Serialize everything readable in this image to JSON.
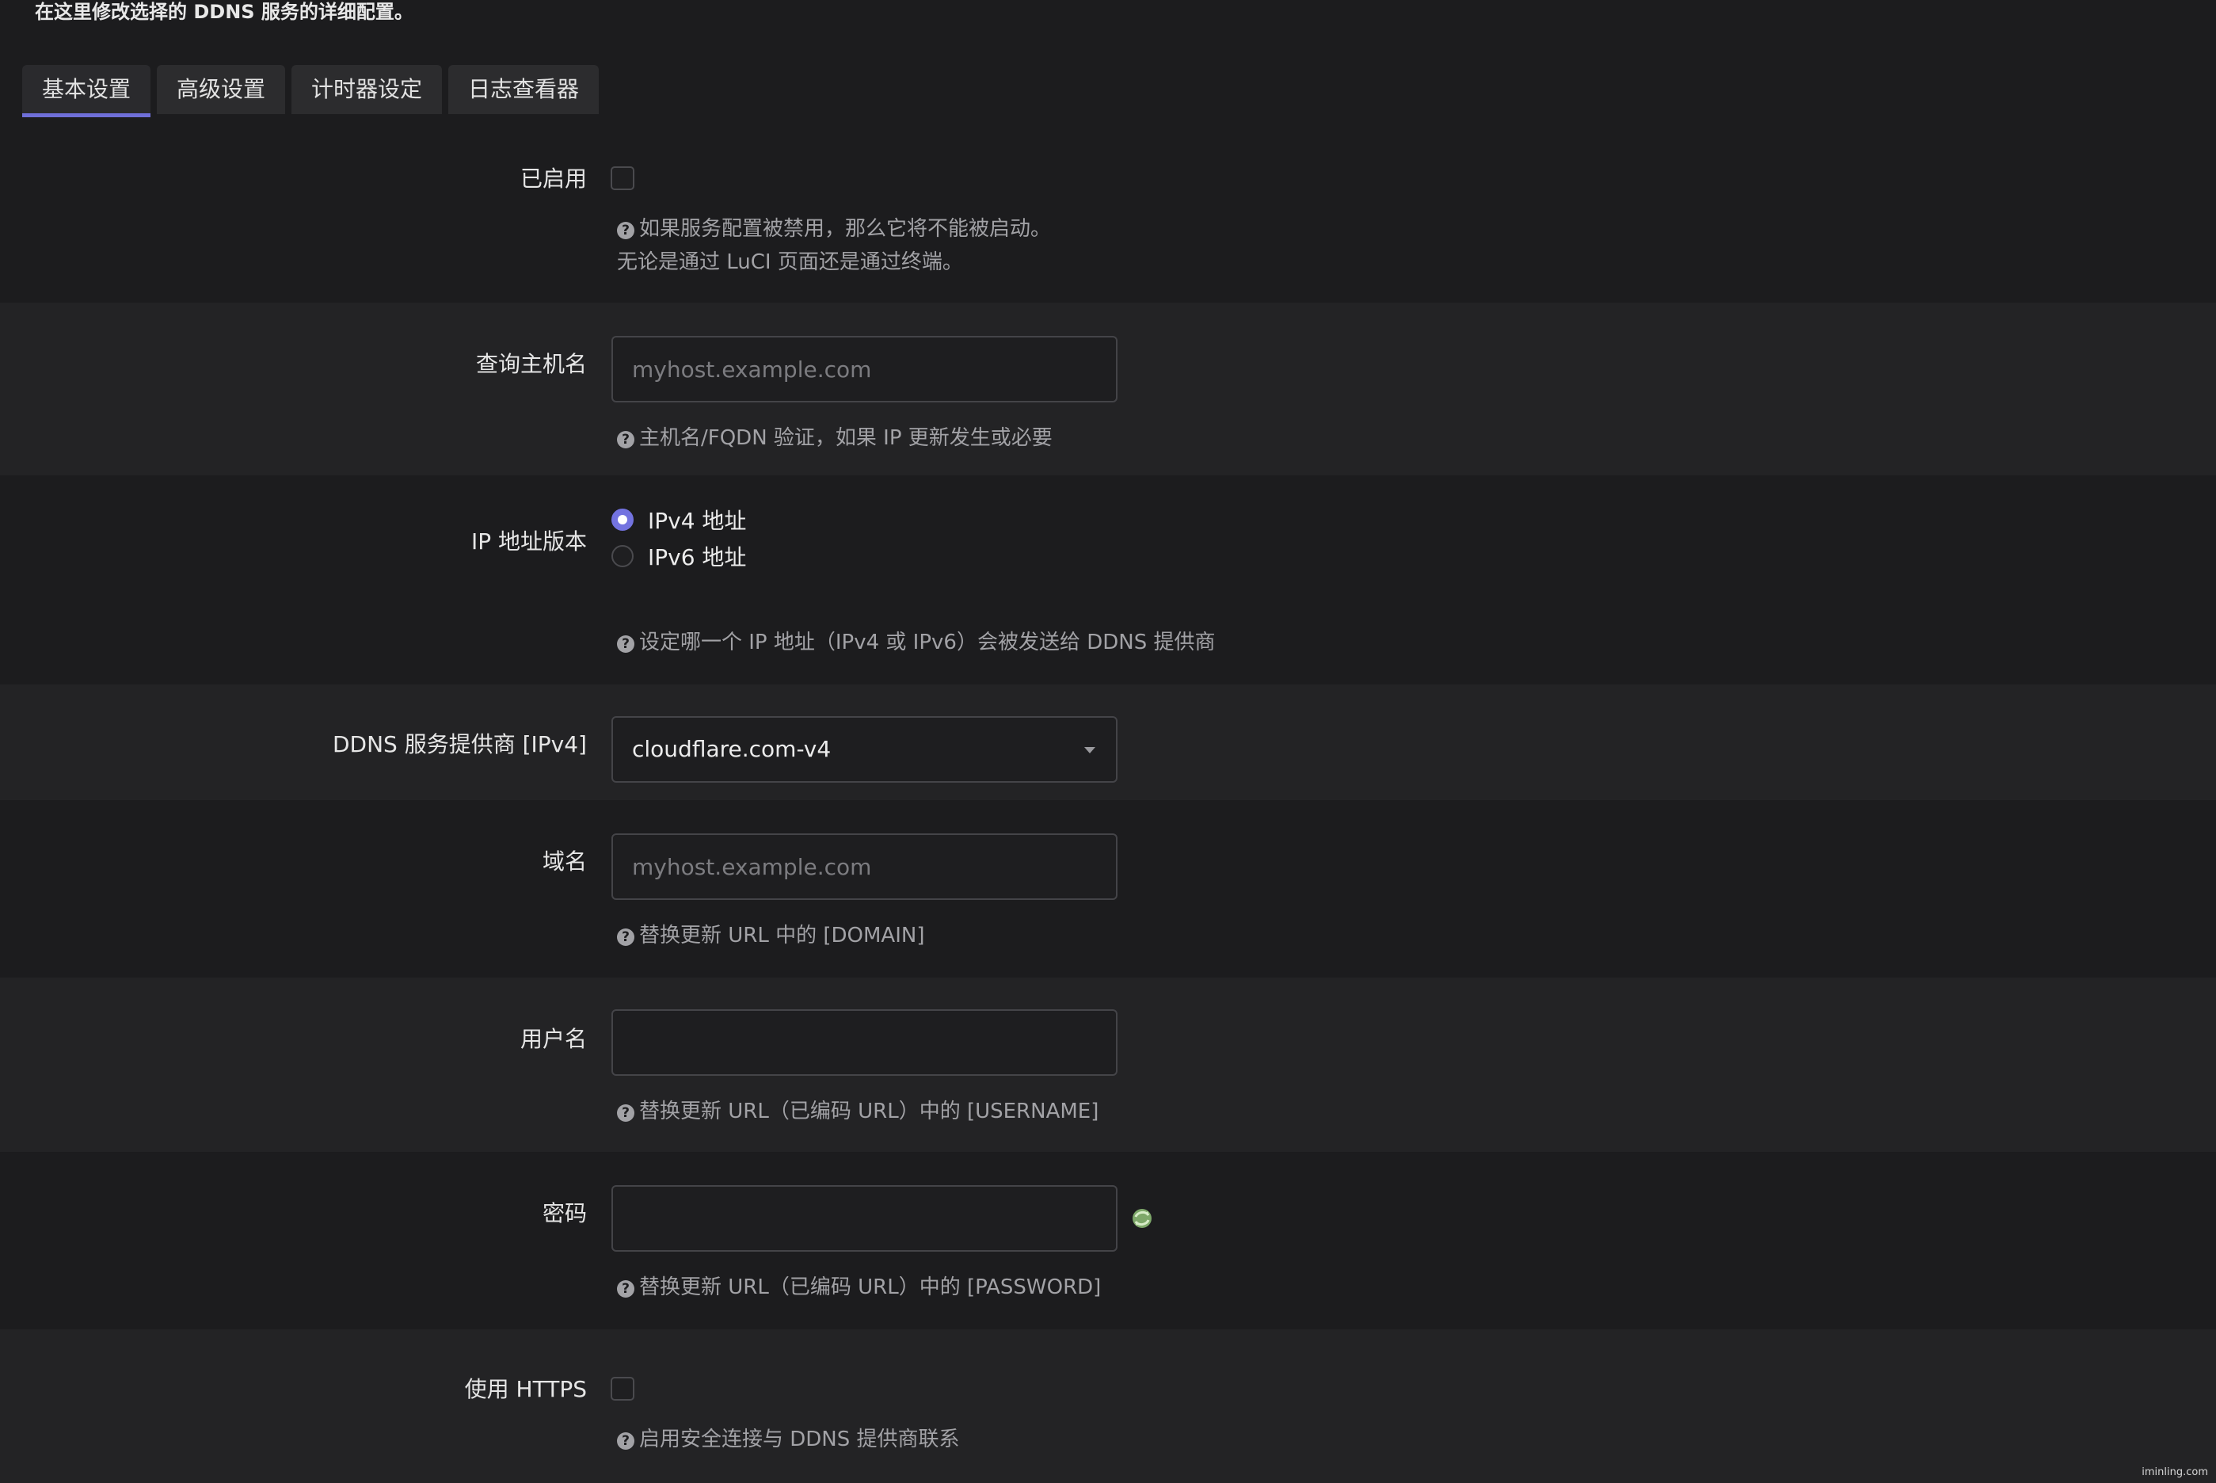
{
  "page": {
    "description": "在这里修改选择的 DDNS 服务的详细配置。",
    "watermark": "iminling.com"
  },
  "tabs": [
    {
      "label": "基本设置",
      "active": true
    },
    {
      "label": "高级设置",
      "active": false
    },
    {
      "label": "计时器设定",
      "active": false
    },
    {
      "label": "日志查看器",
      "active": false
    }
  ],
  "fields": {
    "enabled": {
      "label": "已启用",
      "checked": false,
      "help_line1": "如果服务配置被禁用，那么它将不能被启动。",
      "help_line2": "无论是通过 LuCI 页面还是通过终端。"
    },
    "lookup_host": {
      "label": "查询主机名",
      "placeholder": "myhost.example.com",
      "value": "",
      "help": "主机名/FQDN 验证，如果 IP 更新发生或必要"
    },
    "ip_version": {
      "label": "IP 地址版本",
      "options": [
        {
          "label": "IPv4 地址",
          "checked": true
        },
        {
          "label": "IPv6 地址",
          "checked": false
        }
      ],
      "help": "设定哪一个 IP 地址（IPv4 或 IPv6）会被发送给 DDNS 提供商"
    },
    "provider": {
      "label": "DDNS 服务提供商 [IPv4]",
      "selected": "cloudflare.com-v4"
    },
    "domain": {
      "label": "域名",
      "placeholder": "myhost.example.com",
      "value": "",
      "help": "替换更新 URL 中的 [DOMAIN]"
    },
    "username": {
      "label": "用户名",
      "value": "",
      "help": "替换更新 URL（已编码 URL）中的 [USERNAME]"
    },
    "password": {
      "label": "密码",
      "value": "",
      "help": "替换更新 URL（已编码 URL）中的 [PASSWORD]",
      "reveal_icon": "reveal-password-icon"
    },
    "use_https": {
      "label": "使用 HTTPS",
      "checked": false,
      "help": "启用安全连接与 DDNS 提供商联系"
    }
  },
  "colors": {
    "background": "#1c1c1e",
    "row_alt": "#232325",
    "accent": "#7373e0",
    "text": "#e6e6e6",
    "muted": "#a2a2a6"
  }
}
